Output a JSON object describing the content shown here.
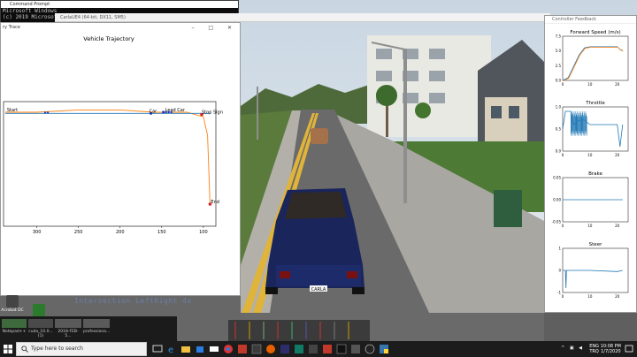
{
  "console": {
    "title": "Command Prompt",
    "lines": [
      "Microsoft Windows",
      "(c) 2019 Microsoft"
    ]
  },
  "carla_window": {
    "title": "CarlaUE4 (64-bit, DX11, SM5)"
  },
  "trajectory_window": {
    "title": "ry Trace",
    "controls": "–  □  ✕",
    "chart_data": {
      "type": "line",
      "title": "Vehicle Trajectory",
      "xlabel": "",
      "ylabel": "",
      "xlim": [
        340,
        85
      ],
      "x_ticks": [
        "300",
        "250",
        "200",
        "150",
        "100"
      ],
      "x_tick_values": [
        300,
        250,
        200,
        150,
        100
      ],
      "annotations": [
        "Start",
        "Car",
        "Lead Car",
        "Stop Sign",
        "End"
      ],
      "series": [
        {
          "values": [
            [
              338,
              0
            ],
            [
              300,
              0
            ],
            [
              250,
              1
            ],
            [
              200,
              1
            ],
            [
              160,
              0
            ],
            [
              120,
              0
            ],
            [
              100,
              -2
            ],
            [
              95,
              -10
            ],
            [
              92,
              -40
            ]
          ],
          "color": "#ff7f0e"
        },
        {
          "values": [
            [
              338,
              -0.5
            ],
            [
              92,
              -0.5
            ]
          ],
          "color": "#1f77b4"
        }
      ],
      "points": {
        "start": [
          338,
          0
        ],
        "car": [
          163,
          -0.5
        ],
        "lead_car": [
          148,
          0
        ],
        "stop_sign": [
          102,
          -1
        ],
        "end": [
          92,
          -40
        ]
      }
    }
  },
  "controller_window": {
    "title": "Controller Feedback",
    "chart_data": [
      {
        "type": "line",
        "title": "Forward Speed (m/s)",
        "ylim": [
          0,
          8
        ],
        "xlim": [
          0,
          24
        ],
        "y_ticks": [
          "7.5",
          "5.0",
          "2.5",
          "0.0"
        ],
        "x_ticks": [
          "0",
          "10",
          "20"
        ],
        "series": [
          {
            "values": [
              [
                0,
                0
              ],
              [
                2,
                0.5
              ],
              [
                4,
                2.5
              ],
              [
                6,
                4.6
              ],
              [
                8,
                5.9
              ],
              [
                10,
                6.1
              ],
              [
                15,
                6.1
              ],
              [
                20,
                6.1
              ],
              [
                21,
                5.6
              ],
              [
                22,
                5.4
              ]
            ]
          }
        ]
      },
      {
        "type": "line",
        "title": "Throttle",
        "ylim": [
          0,
          1
        ],
        "xlim": [
          0,
          24
        ],
        "y_ticks": [
          "1.0",
          "0.5",
          "0.0"
        ],
        "x_ticks": [
          "0",
          "10",
          "20"
        ],
        "series": [
          {
            "values": [
              [
                0,
                0.5
              ],
              [
                1,
                0.9
              ],
              [
                3,
                0.9
              ],
              [
                4,
                0.6
              ],
              [
                6,
                0.7
              ],
              [
                8,
                0.7
              ],
              [
                10,
                0.6
              ],
              [
                15,
                0.6
              ],
              [
                20,
                0.6
              ],
              [
                21,
                0.1
              ],
              [
                22,
                0.6
              ]
            ]
          }
        ]
      },
      {
        "type": "line",
        "title": "Brake",
        "ylim": [
          -0.05,
          0.05
        ],
        "xlim": [
          0,
          24
        ],
        "y_ticks": [
          "0.05",
          "0.00",
          "-0.05"
        ],
        "x_ticks": [
          "0",
          "10",
          "20"
        ],
        "series": [
          {
            "values": [
              [
                0,
                0
              ],
              [
                22,
                0
              ]
            ]
          }
        ]
      },
      {
        "type": "line",
        "title": "Steer",
        "ylim": [
          -1,
          1
        ],
        "xlim": [
          0,
          24
        ],
        "y_ticks": [
          "1",
          "0",
          "-1"
        ],
        "x_ticks": [
          "0",
          "10",
          "20"
        ],
        "series": [
          {
            "values": [
              [
                0,
                0
              ],
              [
                1,
                0
              ],
              [
                1.2,
                -0.8
              ],
              [
                1.4,
                0
              ],
              [
                10,
                0
              ],
              [
                20,
                -0.05
              ],
              [
                22,
                0
              ]
            ]
          }
        ]
      }
    ]
  },
  "scene": {
    "plate": "CARLA",
    "hud_text": "Intersection LeftRight 4x"
  },
  "desktop_icons": [
    {
      "label": "Acrobat DC",
      "color": "#444"
    },
    {
      "label": "Spark 1.0",
      "color": "#2c7a2c"
    }
  ],
  "thumbnails": [
    {
      "label": "Notepad++"
    },
    {
      "label": "cuda_10.0... (1)"
    },
    {
      "label": "2018-FEB-5..."
    },
    {
      "label": "professiona..."
    }
  ],
  "taskbar": {
    "search_placeholder": "Type here to search",
    "lang": "ENG",
    "lang2": "TRQ",
    "time": "10:08 PM",
    "date": "1/7/2020"
  }
}
